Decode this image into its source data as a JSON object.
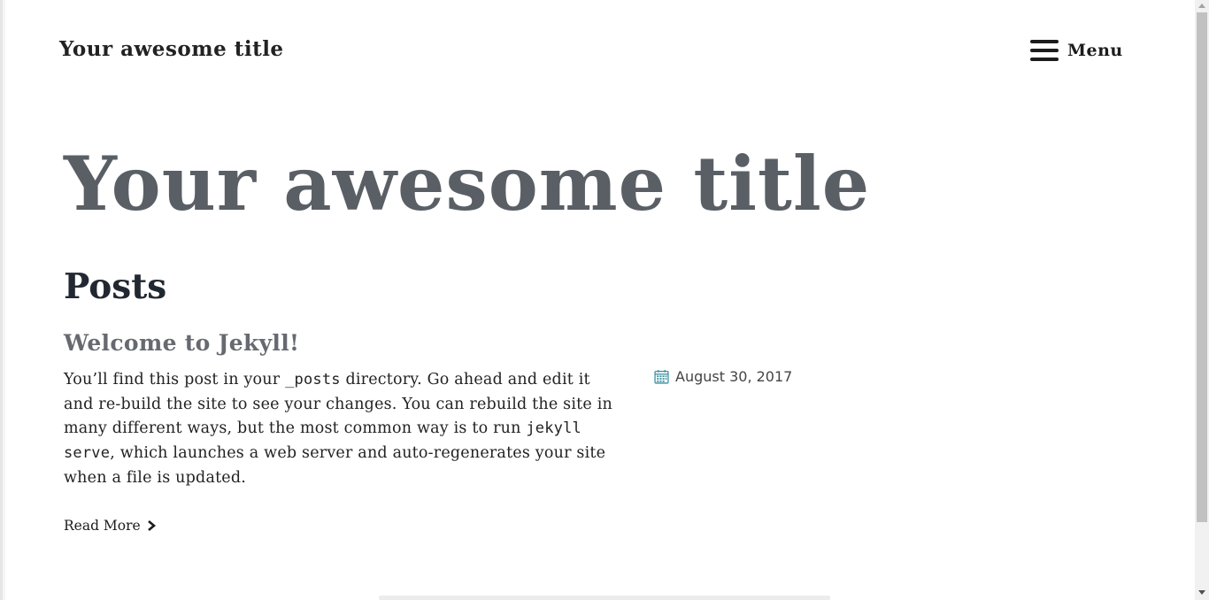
{
  "header": {
    "site_title": "Your awesome title",
    "menu_label": "Menu",
    "menu_icon": "hamburger-icon"
  },
  "hero": {
    "title": "Your awesome title"
  },
  "posts_section": {
    "heading": "Posts",
    "posts": [
      {
        "title": "Welcome to Jekyll!",
        "excerpt_parts": [
          "You’ll find this post in your ",
          "_posts",
          " directory. Go ahead and edit it and re-build the site to see your changes. You can rebuild the site in many different ways, but the most common way is to run ",
          "jekyll serve",
          ", which launches a web server and auto-regenerates your site when a file is updated."
        ],
        "date": "August 30, 2017",
        "date_icon": "calendar-icon",
        "read_more": "Read More",
        "read_more_icon": "chevron-right-icon"
      }
    ]
  },
  "colors": {
    "hero_title": "#5a5f66",
    "heading": "#222831",
    "post_title": "#666a70",
    "calendar_icon": "#3a8fa0"
  }
}
